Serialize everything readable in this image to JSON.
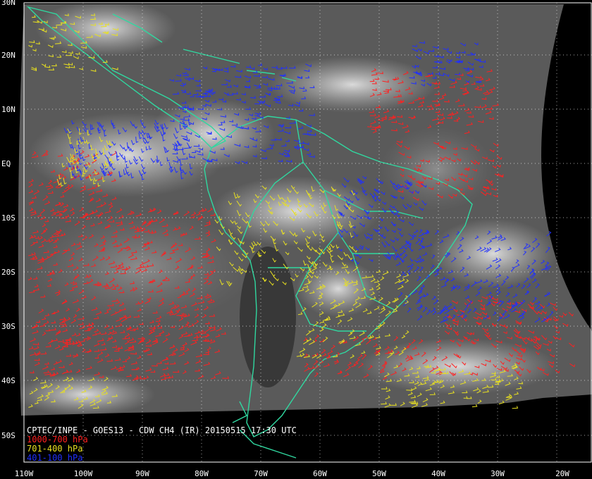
{
  "map": {
    "lat_labels": [
      "30N",
      "20N",
      "10N",
      "EQ",
      "10S",
      "20S",
      "30S",
      "40S",
      "50S"
    ],
    "lon_labels": [
      "110W",
      "100W",
      "90W",
      "80W",
      "70W",
      "60W",
      "50W",
      "40W",
      "30W",
      "20W"
    ],
    "caption": {
      "title": "CPTEC/INPE - GOES13 - CDW CH4 (IR) 20150515 17:30 UTC",
      "legend": [
        {
          "text": "1000-700 hPa",
          "color": "#ff2020"
        },
        {
          "text": "701-400 hPa",
          "color": "#e8e020"
        },
        {
          "text": "401-100 hPa",
          "color": "#2030ff"
        }
      ]
    },
    "colors": {
      "background": "#000000",
      "coastline": "#30d8a0",
      "gridline": "#ffffff",
      "low_level_winds": "#ff2020",
      "mid_level_winds": "#e8e020",
      "high_level_winds": "#2030ff"
    }
  }
}
